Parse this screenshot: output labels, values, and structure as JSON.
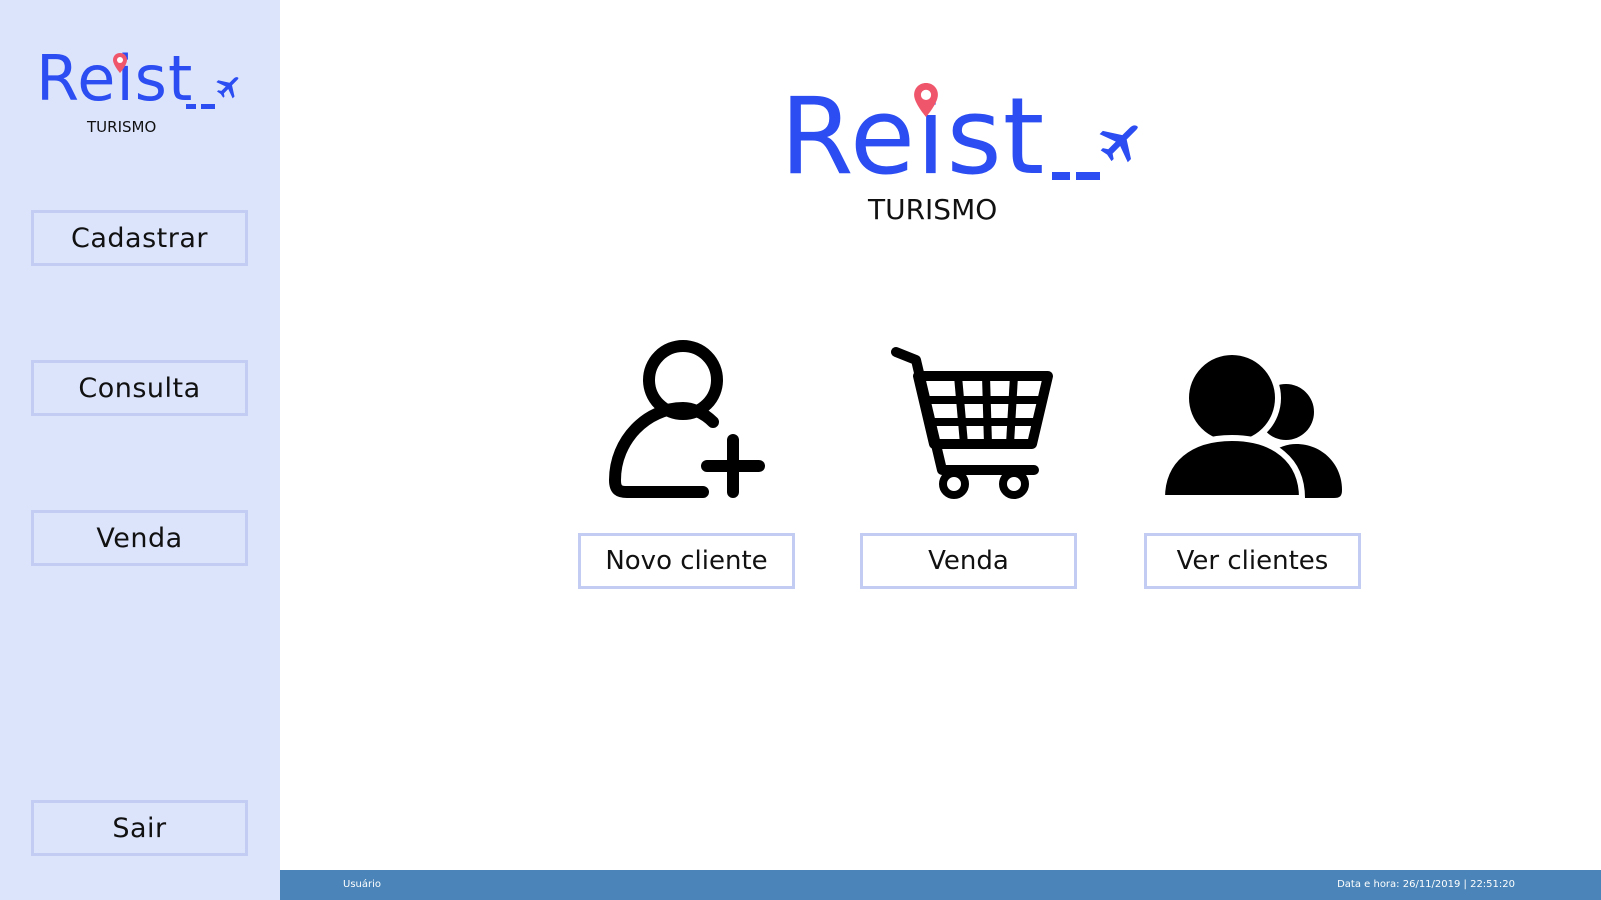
{
  "brand": {
    "name": "Reist",
    "subtitle": "TURISMO",
    "colors": {
      "primary": "#2b4df2",
      "pin": "#f0566b",
      "sidebar_bg": "#dce4fc",
      "button_border": "#c3cdf3",
      "statusbar_bg": "#4a84b8"
    }
  },
  "sidebar": {
    "items": [
      {
        "label": "Cadastrar"
      },
      {
        "label": "Consulta"
      },
      {
        "label": "Venda"
      }
    ],
    "exit_label": "Sair"
  },
  "main": {
    "actions": [
      {
        "icon": "add-user-icon",
        "label": "Novo cliente"
      },
      {
        "icon": "shopping-cart-icon",
        "label": "Venda"
      },
      {
        "icon": "users-group-icon",
        "label": "Ver clientes"
      }
    ]
  },
  "statusbar": {
    "user": "Usuário",
    "datetime": "Data e hora: 26/11/2019 | 22:51:20"
  }
}
